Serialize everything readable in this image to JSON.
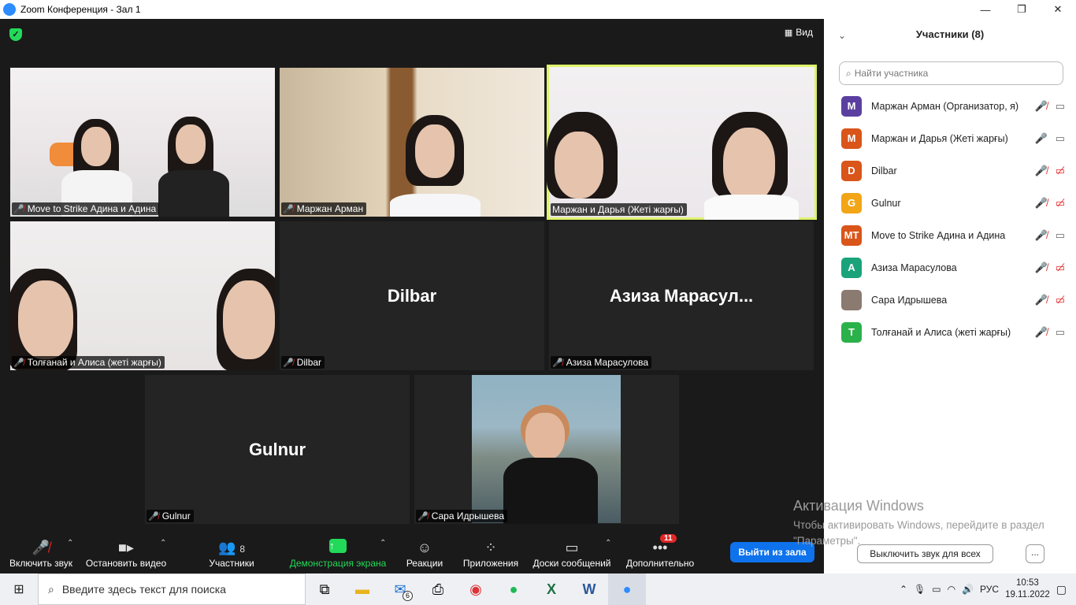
{
  "window": {
    "title": "Zoom Конференция - Зал 1",
    "minimize": "—",
    "maximize": "❐",
    "close": "✕"
  },
  "view_button": "Вид",
  "tiles": [
    {
      "name": "Move to Strike Адина и Адина"
    },
    {
      "name": "Маржан Арман"
    },
    {
      "name": "Маржан и Дарья (Жеті жарғы)"
    },
    {
      "name": "Толғанай и Алиса (жеті жарғы)"
    },
    {
      "name": "Dilbar",
      "big_name": "Dilbar"
    },
    {
      "name": "Азиза Марасулова",
      "big_name": "Азиза  Марасул..."
    },
    {
      "name": "Gulnur",
      "big_name": "Gulnur"
    },
    {
      "name": "Сара Идрышева"
    }
  ],
  "toolbar": {
    "mute": "Включить звук",
    "video": "Остановить видео",
    "participants": "Участники",
    "participants_count": "8",
    "share": "Демонстрация экрана",
    "reactions": "Реакции",
    "apps": "Приложения",
    "boards": "Доски сообщений",
    "more": "Дополнительно",
    "more_badge": "11",
    "leave": "Выйти из зала"
  },
  "panel": {
    "title": "Участники (8)",
    "search_placeholder": "Найти участника",
    "participants": [
      {
        "initials": "M",
        "color": "#5b3fa0",
        "name": "Маржан Арман (Организатор, я)",
        "mic": "off",
        "video": "on"
      },
      {
        "initials": "M",
        "color": "#d9551a",
        "name": "Маржан и Дарья (Жеті жарғы)",
        "mic": "on",
        "video": "on"
      },
      {
        "initials": "D",
        "color": "#d9551a",
        "name": "Dilbar",
        "mic": "off",
        "video": "off"
      },
      {
        "initials": "G",
        "color": "#f2a516",
        "name": "Gulnur",
        "mic": "off",
        "video": "off"
      },
      {
        "initials": "MT",
        "color": "#d9551a",
        "name": "Move to Strike Адина и Адина",
        "mic": "off",
        "video": "on"
      },
      {
        "initials": "A",
        "color": "#1aa37a",
        "name": "Азиза Марасулова",
        "mic": "off",
        "video": "off"
      },
      {
        "initials": "",
        "color": "#8a7a70",
        "name": "Сара Идрышева",
        "mic": "off",
        "video": "off"
      },
      {
        "initials": "T",
        "color": "#2bb14a",
        "name": "Толғанай и Алиса (жеті жарғы)",
        "mic": "off",
        "video": "on"
      }
    ],
    "mute_all": "Выключить звук для всех",
    "more_button": "..."
  },
  "watermark": {
    "line1": "Активация Windows",
    "line2": "Чтобы активировать Windows, перейдите в раздел \"Параметры\"."
  },
  "taskbar": {
    "search_placeholder": "Введите здесь текст для поиска",
    "mail_badge": "6",
    "lang": "РУС",
    "time": "10:53",
    "date": "19.11.2022"
  }
}
